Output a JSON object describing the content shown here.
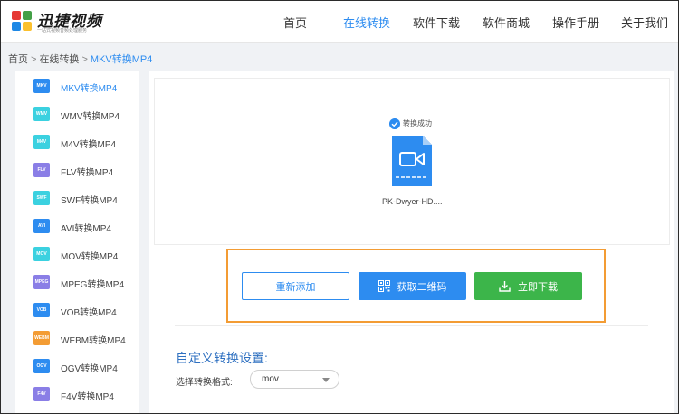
{
  "header": {
    "brand": "迅捷视频",
    "slogan": "一站式视频音频处理服务",
    "nav": [
      {
        "label": "首页",
        "active": false
      },
      {
        "label": "在线转换",
        "active": true
      },
      {
        "label": "软件下载",
        "active": false
      },
      {
        "label": "软件商城",
        "active": false
      },
      {
        "label": "操作手册",
        "active": false
      },
      {
        "label": "关于我们",
        "active": false
      }
    ]
  },
  "breadcrumb": {
    "home": "首页",
    "separator": ">",
    "section": "在线转换",
    "current": "MKV转换MP4"
  },
  "sidebar": {
    "items": [
      {
        "label": "MKV转换MP4",
        "badge": "MKV",
        "color": "#2d8cf0",
        "active": true
      },
      {
        "label": "WMV转换MP4",
        "badge": "WMV",
        "color": "#3bd1e0",
        "active": false
      },
      {
        "label": "M4V转换MP4",
        "badge": "M4V",
        "color": "#3bd1e0",
        "active": false
      },
      {
        "label": "FLV转换MP4",
        "badge": "FLV",
        "color": "#8a7ee6",
        "active": false
      },
      {
        "label": "SWF转换MP4",
        "badge": "SWF",
        "color": "#3bd1e0",
        "active": false
      },
      {
        "label": "AVI转换MP4",
        "badge": "AVI",
        "color": "#2d8cf0",
        "active": false
      },
      {
        "label": "MOV转换MP4",
        "badge": "MOV",
        "color": "#3bd1e0",
        "active": false
      },
      {
        "label": "MPEG转换MP4",
        "badge": "MPEG",
        "color": "#8a7ee6",
        "active": false
      },
      {
        "label": "VOB转换MP4",
        "badge": "VOB",
        "color": "#2d8cf0",
        "active": false
      },
      {
        "label": "WEBM转换MP4",
        "badge": "WEBM",
        "color": "#f39c34",
        "active": false
      },
      {
        "label": "OGV转换MP4",
        "badge": "OGV",
        "color": "#2d8cf0",
        "active": false
      },
      {
        "label": "F4V转换MP4",
        "badge": "F4V",
        "color": "#8a7ee6",
        "active": false
      }
    ]
  },
  "result": {
    "status_text": "转换成功",
    "file_name": "PK-Dwyer-HD...."
  },
  "actions": {
    "readd_label": "重新添加",
    "qr_label": "获取二维码",
    "download_label": "立即下载"
  },
  "settings": {
    "title": "自定义转换设置:",
    "format_label": "选择转换格式:",
    "format_value": "mov"
  },
  "colors": {
    "accent": "#2d8cf0",
    "success": "#3cb54a",
    "highlight": "#f39c34"
  }
}
